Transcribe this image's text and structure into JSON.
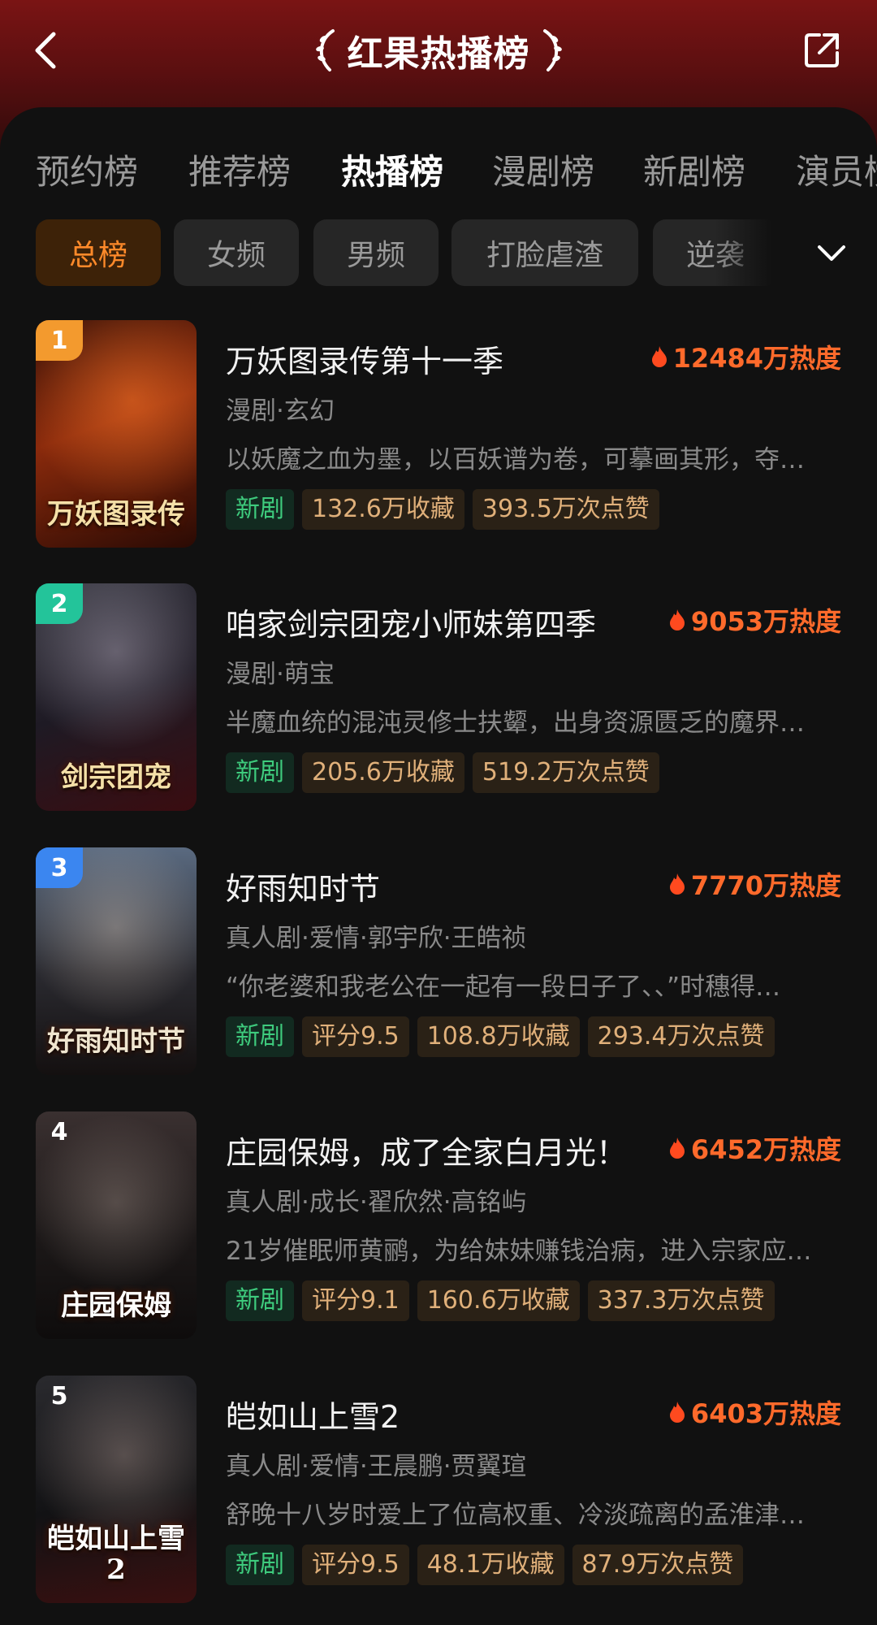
{
  "header": {
    "title": "红果热播榜"
  },
  "tabs": [
    {
      "label": "预约榜",
      "active": false
    },
    {
      "label": "推荐榜",
      "active": false
    },
    {
      "label": "热播榜",
      "active": true
    },
    {
      "label": "漫剧榜",
      "active": false
    },
    {
      "label": "新剧榜",
      "active": false
    },
    {
      "label": "演员榜",
      "active": false
    }
  ],
  "chips": [
    {
      "label": "总榜",
      "active": true
    },
    {
      "label": "女频",
      "active": false
    },
    {
      "label": "男频",
      "active": false
    },
    {
      "label": "打脸虐渣",
      "active": false
    },
    {
      "label": "逆袭",
      "active": false
    }
  ],
  "colors": {
    "accent": "#ff6a2b",
    "rank1": "#f39a2e",
    "rank2": "#23c49a",
    "rank3": "#3b86f0",
    "new_badge_text": "#3ecb7d"
  },
  "items": [
    {
      "rank": "1",
      "title": "万妖图录传第十一季",
      "heat": "12484万热度",
      "tags": "漫剧·玄幻",
      "desc": "以妖魔之血为墨，以百妖谱为卷，可摹画其形，夺…",
      "badges": [
        "新剧",
        "132.6万收藏",
        "393.5万次点赞"
      ],
      "poster_text": "万妖图录传"
    },
    {
      "rank": "2",
      "title": "咱家剑宗团宠小师妹第四季",
      "heat": "9053万热度",
      "tags": "漫剧·萌宝",
      "desc": "半魔血统的混沌灵修士扶颦，出身资源匮乏的魔界…",
      "badges": [
        "新剧",
        "205.6万收藏",
        "519.2万次点赞"
      ],
      "poster_text": "剑宗团宠"
    },
    {
      "rank": "3",
      "title": "好雨知时节",
      "heat": "7770万热度",
      "tags": "真人剧·爱情·郭宇欣·王皓祯",
      "desc": "“你老婆和我老公在一起有一段日子了、、”时穗得…",
      "badges": [
        "新剧",
        "评分9.5",
        "108.8万收藏",
        "293.4万次点赞"
      ],
      "poster_text": "好雨知时节"
    },
    {
      "rank": "4",
      "title": "庄园保姆，成了全家白月光！",
      "heat": "6452万热度",
      "tags": "真人剧·成长·翟欣然·高铭屿",
      "desc": "21岁催眠师黄鹂，为给妹妹赚钱治病，进入宗家应…",
      "badges": [
        "新剧",
        "评分9.1",
        "160.6万收藏",
        "337.3万次点赞"
      ],
      "poster_text": "庄园保姆"
    },
    {
      "rank": "5",
      "title": "皑如山上雪2",
      "heat": "6403万热度",
      "tags": "真人剧·爱情·王晨鹏·贾翼瑄",
      "desc": "舒晚十八岁时爱上了位高权重、冷淡疏离的孟淮津…",
      "badges": [
        "新剧",
        "评分9.5",
        "48.1万收藏",
        "87.9万次点赞"
      ],
      "poster_text": "皑如山上雪2"
    }
  ]
}
